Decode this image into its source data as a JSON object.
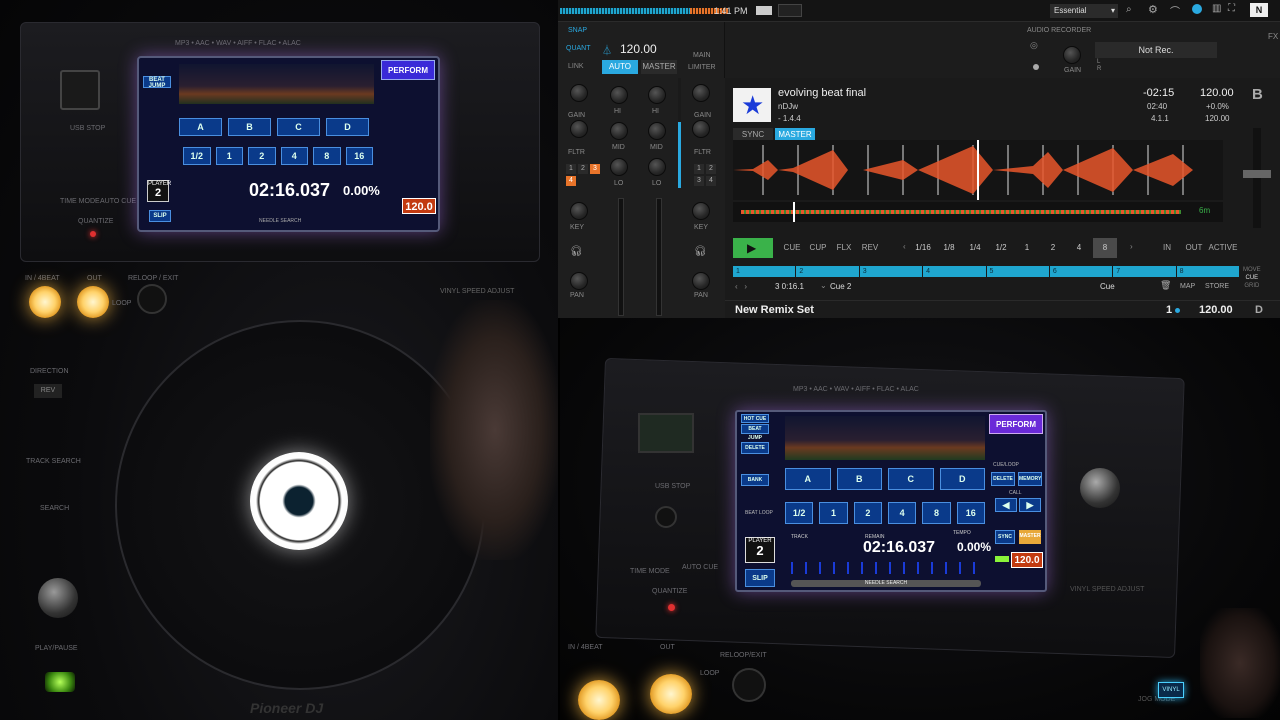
{
  "left_cdj": {
    "formats": "MP3 • AAC • WAV • AIFF • FLAC • ALAC",
    "usb_stop": "USB STOP",
    "time_mode": "TIME MODE",
    "auto_cue": "AUTO CUE",
    "quantize": "QUANTIZE",
    "buttons": {
      "in": "IN / 4BEAT",
      "out": "OUT",
      "reloop": "RELOOP / EXIT",
      "loop": "LOOP"
    },
    "direction": "DIRECTION",
    "rev": "REV",
    "track_search": "TRACK SEARCH",
    "search": "SEARCH",
    "play_pause": "PLAY/PAUSE",
    "vinyl_speed": "VINYL SPEED ADJUST",
    "brand": "Pioneer DJ",
    "screen": {
      "perform": "PERFORM",
      "beat_jump": "BEAT JUMP",
      "hot_cues": [
        "A",
        "B",
        "C",
        "D"
      ],
      "beats": [
        "1/2",
        "1",
        "2",
        "4",
        "8",
        "16"
      ],
      "player_label": "PLAYER",
      "player": "2",
      "time": "02:16.037",
      "tempo": "0.00%",
      "bpm": "120.0",
      "slip": "SLIP",
      "needle": "NEEDLE SEARCH"
    }
  },
  "right_cdj": {
    "formats": "MP3 • AAC • WAV • AIFF • FLAC • ALAC",
    "usb_stop": "USB STOP",
    "time_mode": "TIME MODE",
    "auto_cue": "AUTO CUE",
    "quantize": "QUANTIZE",
    "buttons": {
      "in": "IN / 4BEAT",
      "out": "OUT",
      "reloop": "RELOOP/EXIT",
      "loop": "LOOP"
    },
    "vinyl_speed": "VINYL SPEED ADJUST",
    "vinyl": "VINYL",
    "jog_mode": "JOG MODE",
    "screen": {
      "hot_cue": "HOT CUE",
      "beat_jump": "BEAT JUMP",
      "delete": "DELETE",
      "bank": "BANK",
      "beat_loop": "BEAT LOOP",
      "perform": "PERFORM",
      "cue_loop": "CUE/LOOP",
      "call": "CALL",
      "memory": "MEMORY",
      "delete2": "DELETE",
      "hot_cues": [
        "A",
        "B",
        "C",
        "D"
      ],
      "beats": [
        "1/2",
        "1",
        "2",
        "4",
        "8",
        "16"
      ],
      "player_label": "PLAYER",
      "player": "2",
      "track_label": "TRACK",
      "remain": "REMAIN",
      "tempo_label": "TEMPO",
      "time": "02:16.037",
      "tempo": "0.00%",
      "sync": "SYNC",
      "master": "MASTER",
      "bpm": "120.0",
      "slip": "SLIP",
      "needle": "NEEDLE SEARCH"
    }
  },
  "traktor": {
    "clock": "1:41 PM",
    "layout": "Essential",
    "fx": "FX",
    "snap": "SNAP",
    "quant": "QUANT",
    "link": "LINK",
    "tempo": "120.00",
    "auto": "AUTO",
    "master": "MASTER",
    "main": "MAIN",
    "limiter": "LIMITER",
    "audio_recorder": "AUDIO RECORDER",
    "gain": "GAIN",
    "not_rec": "Not Rec.",
    "l": "L",
    "r": "R",
    "mixer": {
      "gain": "GAIN",
      "hi": "HI",
      "fltr": "FLTR",
      "mid": "MID",
      "lo": "LO",
      "key": "KEY",
      "pan": "PAN",
      "fx_left": [
        "1",
        "2",
        "3",
        "4"
      ],
      "fx_right": [
        "1",
        "2",
        "3",
        "4"
      ]
    },
    "deck_b": {
      "letter": "B",
      "title": "evolving beat final",
      "artist": "nDJw",
      "key_text": "- 1.4.4",
      "remaining": "-02:15",
      "elapsed": "02:40",
      "beat_pos": "4.1.1",
      "bpm": "120.00",
      "pitch": "+0.0%",
      "bpm2": "120.00",
      "sync": "SYNC",
      "master": "MASTER",
      "zoom": "6m",
      "transport": [
        "CUE",
        "CUP",
        "FLX",
        "REV"
      ],
      "loop_sizes": [
        "1/16",
        "1/8",
        "1/4",
        "1/2",
        "1",
        "2",
        "4",
        "8"
      ],
      "in": "IN",
      "out": "OUT",
      "active": "ACTIVE",
      "cues": [
        "1",
        "2",
        "3",
        "4",
        "5",
        "6",
        "7",
        "8"
      ],
      "cue_pos": "3  0:16.1",
      "cue_name": "Cue 2",
      "cue_type": "Cue",
      "map": "MAP",
      "store": "STORE",
      "move": "MOVE",
      "cue_mode": "CUE",
      "grid": "GRID"
    },
    "deck_d": {
      "title": "New Remix Set",
      "num": "1",
      "bpm": "120.00",
      "letter": "D"
    },
    "hotcue_active_index": 7,
    "loop_active_index": 7
  }
}
